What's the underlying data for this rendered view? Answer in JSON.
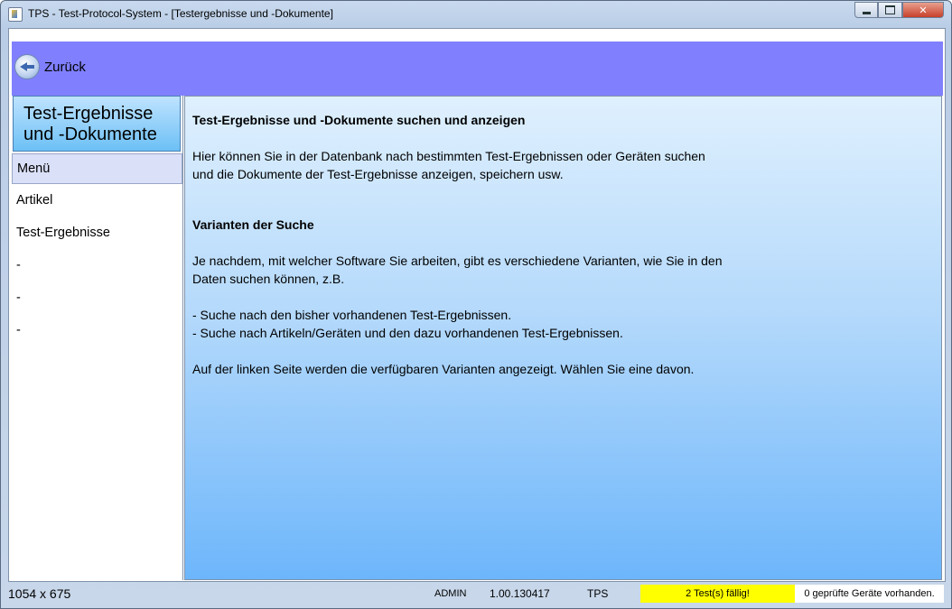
{
  "window": {
    "title": "TPS - Test-Protocol-System - [Testergebnisse und -Dokumente]",
    "controls": {
      "minimize": "minimize",
      "maximize": "maximize",
      "close": "✕"
    }
  },
  "nav": {
    "back_label": "Zurück"
  },
  "sidebar": {
    "header": "Test-Ergebnisse und -Dokumente",
    "items": [
      {
        "label": "Menü"
      },
      {
        "label": "Artikel"
      },
      {
        "label": "Test-Ergebnisse"
      },
      {
        "label": "-"
      },
      {
        "label": "-"
      },
      {
        "label": "-"
      }
    ]
  },
  "content": {
    "heading1": "Test-Ergebnisse und -Dokumente suchen und anzeigen",
    "intro_line1": "Hier können Sie in der Datenbank nach bestimmten Test-Ergebnissen oder Geräten suchen",
    "intro_line2": "und die Dokumente der Test-Ergebnisse anzeigen, speichern usw.",
    "heading2": "Varianten der Suche",
    "variants_line1": "Je nachdem, mit welcher Software Sie arbeiten, gibt es verschiedene Varianten, wie Sie in den",
    "variants_line2": "Daten suchen können, z.B.",
    "bullet1": "- Suche nach den bisher vorhandenen Test-Ergebnissen.",
    "bullet2": "- Suche nach Artikeln/Geräten und den dazu vorhandenen Test-Ergebnissen.",
    "outro": "Auf der linken Seite werden die verfügbaren Varianten angezeigt. Wählen Sie eine davon."
  },
  "statusbar": {
    "size": "1054 x 675",
    "user": "ADMIN",
    "version": "1.00.130417",
    "app": "TPS",
    "tests_due": "2 Test(s) fällig!",
    "checked_devices": "0 geprüfte Geräte vorhanden."
  },
  "colors": {
    "topbar": "#8080ff",
    "due_highlight": "#ffff00",
    "sidebar_header": "#6cc0f5",
    "active_item": "#dae0f7"
  },
  "icons": {
    "back": "back-arrow-icon",
    "app": "app-icon"
  }
}
